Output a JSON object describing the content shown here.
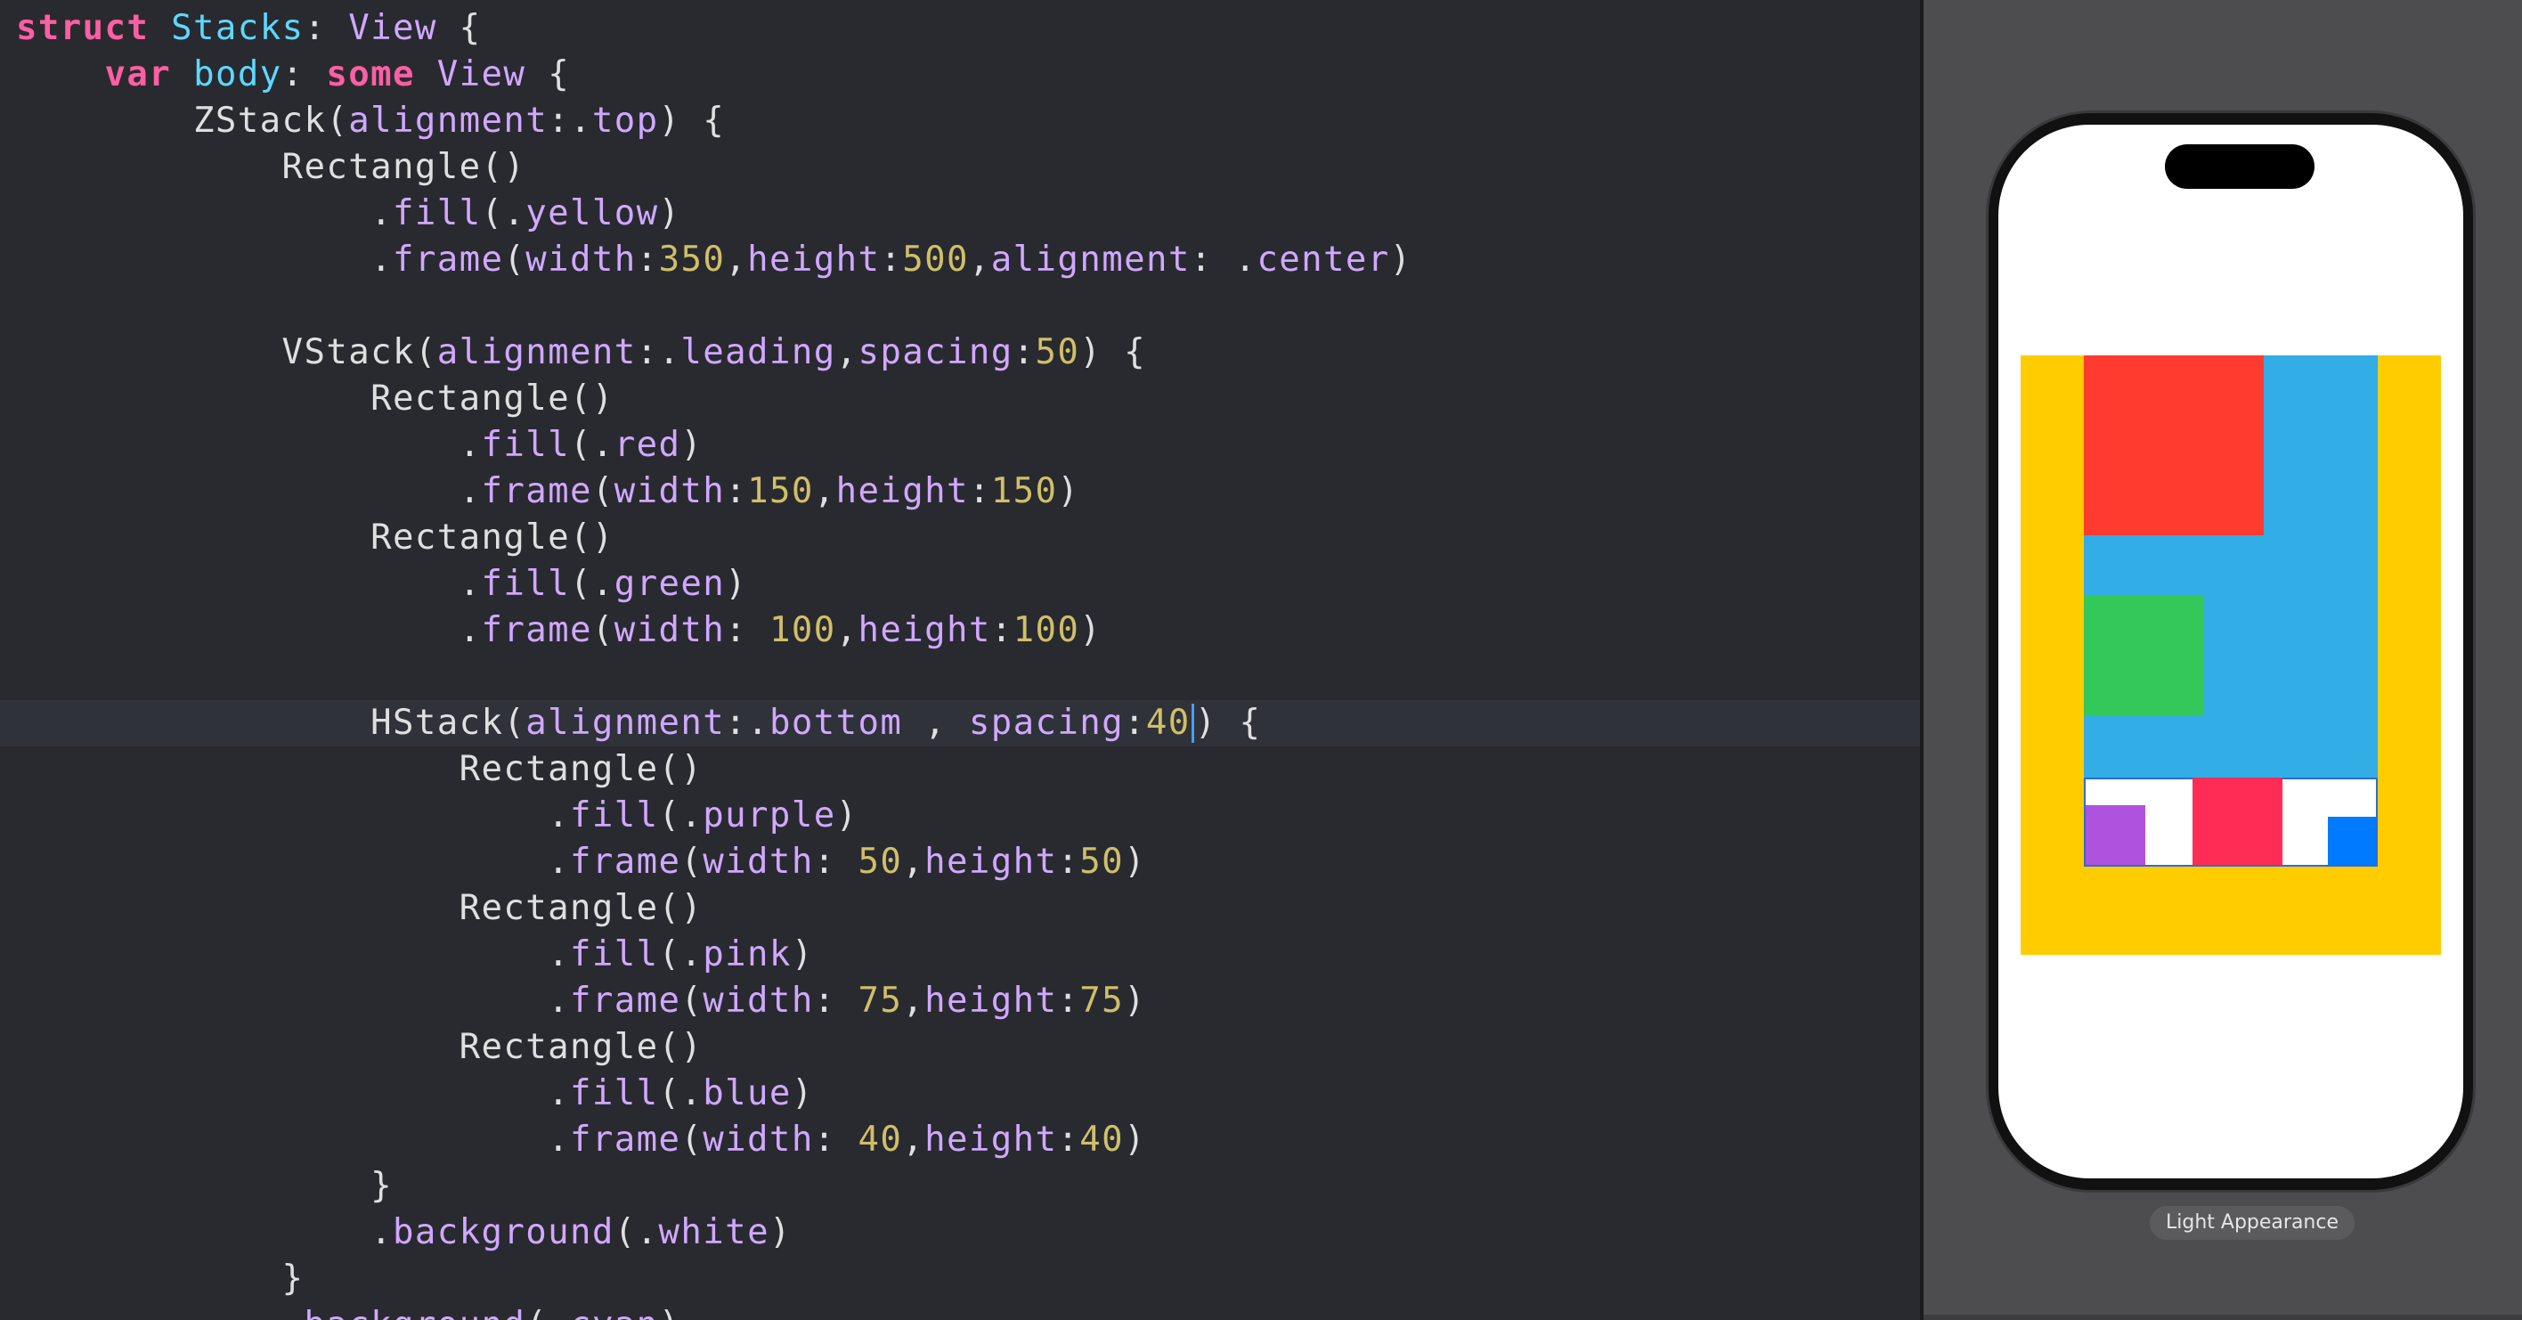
{
  "editor": {
    "lines": [
      [
        [
          "kw",
          "struct"
        ],
        [
          "pl",
          " "
        ],
        [
          "ty",
          "Stacks"
        ],
        [
          "pl",
          ": "
        ],
        [
          "id",
          "View"
        ],
        [
          "pl",
          " {"
        ]
      ],
      [
        [
          "pl",
          "    "
        ],
        [
          "kw",
          "var"
        ],
        [
          "pl",
          " "
        ],
        [
          "ty",
          "body"
        ],
        [
          "pl",
          ": "
        ],
        [
          "kw",
          "some"
        ],
        [
          "pl",
          " "
        ],
        [
          "id",
          "View"
        ],
        [
          "pl",
          " {"
        ]
      ],
      [
        [
          "pl",
          "        ZStack("
        ],
        [
          "id",
          "alignment"
        ],
        [
          "pl",
          ":."
        ],
        [
          "id",
          "top"
        ],
        [
          "pl",
          ") {"
        ]
      ],
      [
        [
          "pl",
          "            Rectangle()"
        ]
      ],
      [
        [
          "pl",
          "                ."
        ],
        [
          "id",
          "fill"
        ],
        [
          "pl",
          "(."
        ],
        [
          "id",
          "yellow"
        ],
        [
          "pl",
          ")"
        ]
      ],
      [
        [
          "pl",
          "                ."
        ],
        [
          "id",
          "frame"
        ],
        [
          "pl",
          "("
        ],
        [
          "id",
          "width"
        ],
        [
          "pl",
          ":"
        ],
        [
          "nm",
          "350"
        ],
        [
          "pl",
          ","
        ],
        [
          "id",
          "height"
        ],
        [
          "pl",
          ":"
        ],
        [
          "nm",
          "500"
        ],
        [
          "pl",
          ","
        ],
        [
          "id",
          "alignment"
        ],
        [
          "pl",
          ": ."
        ],
        [
          "id",
          "center"
        ],
        [
          "pl",
          ")"
        ]
      ],
      [
        [
          "pl",
          ""
        ]
      ],
      [
        [
          "pl",
          "            VStack("
        ],
        [
          "id",
          "alignment"
        ],
        [
          "pl",
          ":."
        ],
        [
          "id",
          "leading"
        ],
        [
          "pl",
          ","
        ],
        [
          "id",
          "spacing"
        ],
        [
          "pl",
          ":"
        ],
        [
          "nm",
          "50"
        ],
        [
          "pl",
          ") {"
        ]
      ],
      [
        [
          "pl",
          "                Rectangle()"
        ]
      ],
      [
        [
          "pl",
          "                    ."
        ],
        [
          "id",
          "fill"
        ],
        [
          "pl",
          "(."
        ],
        [
          "id",
          "red"
        ],
        [
          "pl",
          ")"
        ]
      ],
      [
        [
          "pl",
          "                    ."
        ],
        [
          "id",
          "frame"
        ],
        [
          "pl",
          "("
        ],
        [
          "id",
          "width"
        ],
        [
          "pl",
          ":"
        ],
        [
          "nm",
          "150"
        ],
        [
          "pl",
          ","
        ],
        [
          "id",
          "height"
        ],
        [
          "pl",
          ":"
        ],
        [
          "nm",
          "150"
        ],
        [
          "pl",
          ")"
        ]
      ],
      [
        [
          "pl",
          "                Rectangle()"
        ]
      ],
      [
        [
          "pl",
          "                    ."
        ],
        [
          "id",
          "fill"
        ],
        [
          "pl",
          "(."
        ],
        [
          "id",
          "green"
        ],
        [
          "pl",
          ")"
        ]
      ],
      [
        [
          "pl",
          "                    ."
        ],
        [
          "id",
          "frame"
        ],
        [
          "pl",
          "("
        ],
        [
          "id",
          "width"
        ],
        [
          "pl",
          ": "
        ],
        [
          "nm",
          "100"
        ],
        [
          "pl",
          ","
        ],
        [
          "id",
          "height"
        ],
        [
          "pl",
          ":"
        ],
        [
          "nm",
          "100"
        ],
        [
          "pl",
          ")"
        ]
      ],
      [
        [
          "pl",
          ""
        ]
      ],
      [
        [
          "pl",
          "                HStack("
        ],
        [
          "id",
          "alignment"
        ],
        [
          "pl",
          ":."
        ],
        [
          "id",
          "bottom"
        ],
        [
          "pl",
          " , "
        ],
        [
          "id",
          "spacing"
        ],
        [
          "pl",
          ":"
        ],
        [
          "nm",
          "40"
        ],
        [
          "cur",
          ""
        ],
        [
          "pl",
          ") {"
        ]
      ],
      [
        [
          "pl",
          "                    Rectangle()"
        ]
      ],
      [
        [
          "pl",
          "                        ."
        ],
        [
          "id",
          "fill"
        ],
        [
          "pl",
          "(."
        ],
        [
          "id",
          "purple"
        ],
        [
          "pl",
          ")"
        ]
      ],
      [
        [
          "pl",
          "                        ."
        ],
        [
          "id",
          "frame"
        ],
        [
          "pl",
          "("
        ],
        [
          "id",
          "width"
        ],
        [
          "pl",
          ": "
        ],
        [
          "nm",
          "50"
        ],
        [
          "pl",
          ","
        ],
        [
          "id",
          "height"
        ],
        [
          "pl",
          ":"
        ],
        [
          "nm",
          "50"
        ],
        [
          "pl",
          ")"
        ]
      ],
      [
        [
          "pl",
          "                    Rectangle()"
        ]
      ],
      [
        [
          "pl",
          "                        ."
        ],
        [
          "id",
          "fill"
        ],
        [
          "pl",
          "(."
        ],
        [
          "id",
          "pink"
        ],
        [
          "pl",
          ")"
        ]
      ],
      [
        [
          "pl",
          "                        ."
        ],
        [
          "id",
          "frame"
        ],
        [
          "pl",
          "("
        ],
        [
          "id",
          "width"
        ],
        [
          "pl",
          ": "
        ],
        [
          "nm",
          "75"
        ],
        [
          "pl",
          ","
        ],
        [
          "id",
          "height"
        ],
        [
          "pl",
          ":"
        ],
        [
          "nm",
          "75"
        ],
        [
          "pl",
          ")"
        ]
      ],
      [
        [
          "pl",
          "                    Rectangle()"
        ]
      ],
      [
        [
          "pl",
          "                        ."
        ],
        [
          "id",
          "fill"
        ],
        [
          "pl",
          "(."
        ],
        [
          "id",
          "blue"
        ],
        [
          "pl",
          ")"
        ]
      ],
      [
        [
          "pl",
          "                        ."
        ],
        [
          "id",
          "frame"
        ],
        [
          "pl",
          "("
        ],
        [
          "id",
          "width"
        ],
        [
          "pl",
          ": "
        ],
        [
          "nm",
          "40"
        ],
        [
          "pl",
          ","
        ],
        [
          "id",
          "height"
        ],
        [
          "pl",
          ":"
        ],
        [
          "nm",
          "40"
        ],
        [
          "pl",
          ")"
        ]
      ],
      [
        [
          "pl",
          "                }"
        ]
      ],
      [
        [
          "pl",
          "                ."
        ],
        [
          "id",
          "background"
        ],
        [
          "pl",
          "(."
        ],
        [
          "id",
          "white"
        ],
        [
          "pl",
          ")"
        ]
      ],
      [
        [
          "pl",
          "            }"
        ]
      ],
      [
        [
          "pl",
          "            ."
        ],
        [
          "id",
          "background"
        ],
        [
          "pl",
          "(."
        ],
        [
          "id",
          "cyan"
        ],
        [
          "pl",
          ")"
        ]
      ]
    ],
    "active_line_index": 15
  },
  "preview": {
    "appearance_label": "Light Appearance",
    "colors": {
      "yellow": "#ffcc00",
      "cyan": "#32ade6",
      "red": "#ff3b30",
      "green": "#34c759",
      "white": "#ffffff",
      "purple": "#af52de",
      "pink": "#ff2d55",
      "blue": "#007aff"
    }
  }
}
